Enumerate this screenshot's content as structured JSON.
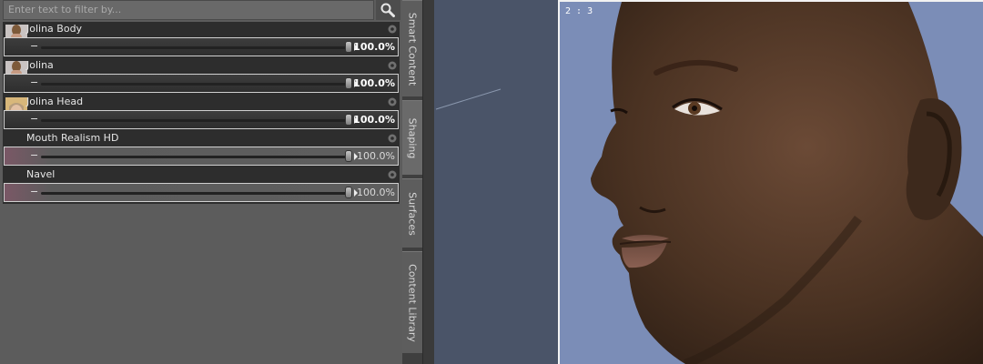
{
  "filter": {
    "placeholder": "Enter text to filter by..."
  },
  "items": [
    {
      "label": "Jolina Body",
      "value": "100.0%",
      "thumb": "body-thumb"
    },
    {
      "label": "Jolina",
      "value": "100.0%",
      "thumb": "body-thumb"
    },
    {
      "label": "Jolina Head",
      "value": "100.0%",
      "thumb": "face-thumb"
    },
    {
      "label": "Mouth Realism HD",
      "value": "100.0%",
      "thumb": ""
    },
    {
      "label": "Navel",
      "value": "100.0%",
      "thumb": ""
    }
  ],
  "tabs": [
    "Smart Content",
    "Shaping",
    "Surfaces",
    "Content Library"
  ],
  "viewport": {
    "aspect_label": "2 : 3"
  },
  "colors": {
    "panel": "#5c5c5c",
    "row_bg": "#2d2d2d",
    "viewport_bg": "#4a5468",
    "render_bg": "#7b8db7"
  }
}
